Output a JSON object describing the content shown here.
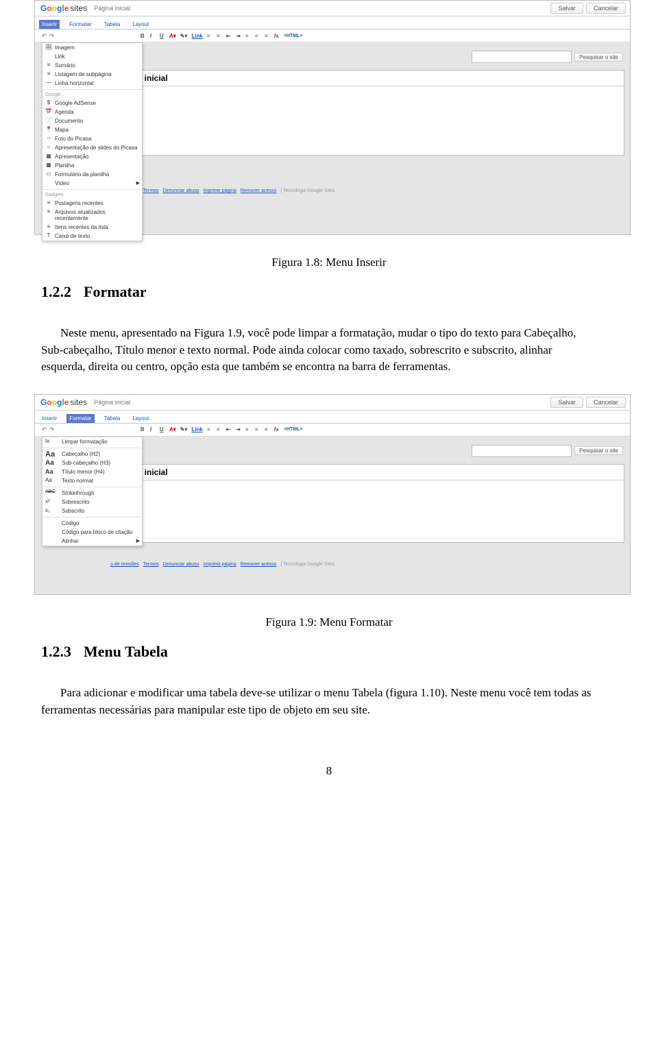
{
  "ss1": {
    "logo_sites": "sites",
    "breadcrumb": "Página inicial",
    "btn_save": "Salvar",
    "btn_cancel": "Cancelar",
    "tabs": [
      "Inserir",
      "Formatar",
      "Tabela",
      "Layout"
    ],
    "toolbar_link": "Link",
    "toolbar_html": "<HTML>",
    "menu_groups": [
      {
        "items": [
          {
            "icon": "🖼",
            "label": "Imagem"
          },
          {
            "icon": "",
            "label": "Link"
          },
          {
            "icon": "≡",
            "label": "Sumário"
          },
          {
            "icon": "≡",
            "label": "Listagem de subpágina"
          },
          {
            "icon": "—",
            "label": "Linha horizontal"
          }
        ]
      },
      {
        "head": "Google...",
        "items": [
          {
            "icon": "$",
            "label": "Google AdSense"
          },
          {
            "icon": "📅",
            "label": "Agenda"
          },
          {
            "icon": "📄",
            "label": "Documento"
          },
          {
            "icon": "📍",
            "label": "Mapa"
          },
          {
            "icon": "○",
            "label": "Foto do Picasa"
          },
          {
            "icon": "○",
            "label": "Apresentação de slides do Picasa"
          },
          {
            "icon": "▦",
            "label": "Apresentação"
          },
          {
            "icon": "▦",
            "label": "Planilha"
          },
          {
            "icon": "▭",
            "label": "Formulário da planilha"
          },
          {
            "icon": "",
            "label": "Vídeo",
            "submenu": true
          }
        ]
      },
      {
        "head": "Gadgets",
        "items": [
          {
            "icon": "≡",
            "label": "Postagens recentes"
          },
          {
            "icon": "≡",
            "label": "Arquivos atualizados recentemente"
          },
          {
            "icon": "≡",
            "label": "Itens recentes da lista"
          },
          {
            "icon": "T",
            "label": "Caixa de texto"
          }
        ]
      }
    ],
    "doc_title": "Página inicial",
    "search_btn": "Pesquisar o site",
    "footer_links": [
      "o de revisões",
      "Termos",
      "Denunciar abuso",
      "Imprimir página",
      "Remover acesso"
    ],
    "footer_tail": "| Tecnologia Google Sites"
  },
  "caption1": "Figura 1.8: Menu Inserir",
  "sec122_num": "1.2.2",
  "sec122_title": "Formatar",
  "para122": "Neste menu, apresentado na Figura 1.9, você pode limpar a formatação, mudar o tipo do texto para Cabeçalho, Sub-cabeçalho, Título menor e texto normal. Pode ainda colocar como taxado, sobrescrito e subscrito, alinhar esquerda, direita ou centro, opção esta que também se encontra na barra de ferramentas.",
  "ss2": {
    "menu_items": [
      {
        "icon": "Ix",
        "label": "Limpar formatação"
      },
      {
        "icon": "Aa",
        "label": "Cabeçalho (H2)"
      },
      {
        "icon": "Aa",
        "label": "Sub-cabeçalho (H3)"
      },
      {
        "icon": "Aa",
        "label": "Título menor (H4)"
      },
      {
        "icon": "Aa",
        "label": "Texto normal"
      },
      {
        "icon": "ABC",
        "label": "Strikethrough"
      },
      {
        "icon": "x²",
        "label": "Sobrescrito"
      },
      {
        "icon": "x₂",
        "label": "Subscrito"
      },
      {
        "icon": "",
        "label": "Código"
      },
      {
        "icon": "",
        "label": "Código para bloco de citação"
      },
      {
        "icon": "",
        "label": "Alinhar",
        "submenu": true
      }
    ]
  },
  "caption2": "Figura 1.9: Menu Formatar",
  "sec123_num": "1.2.3",
  "sec123_title": "Menu Tabela",
  "para123": "Para adicionar e modificar uma tabela deve-se utilizar o menu Tabela (figura 1.10). Neste menu você tem todas as ferramentas necessárias para manipular este tipo de objeto em seu site.",
  "page_num": "8"
}
